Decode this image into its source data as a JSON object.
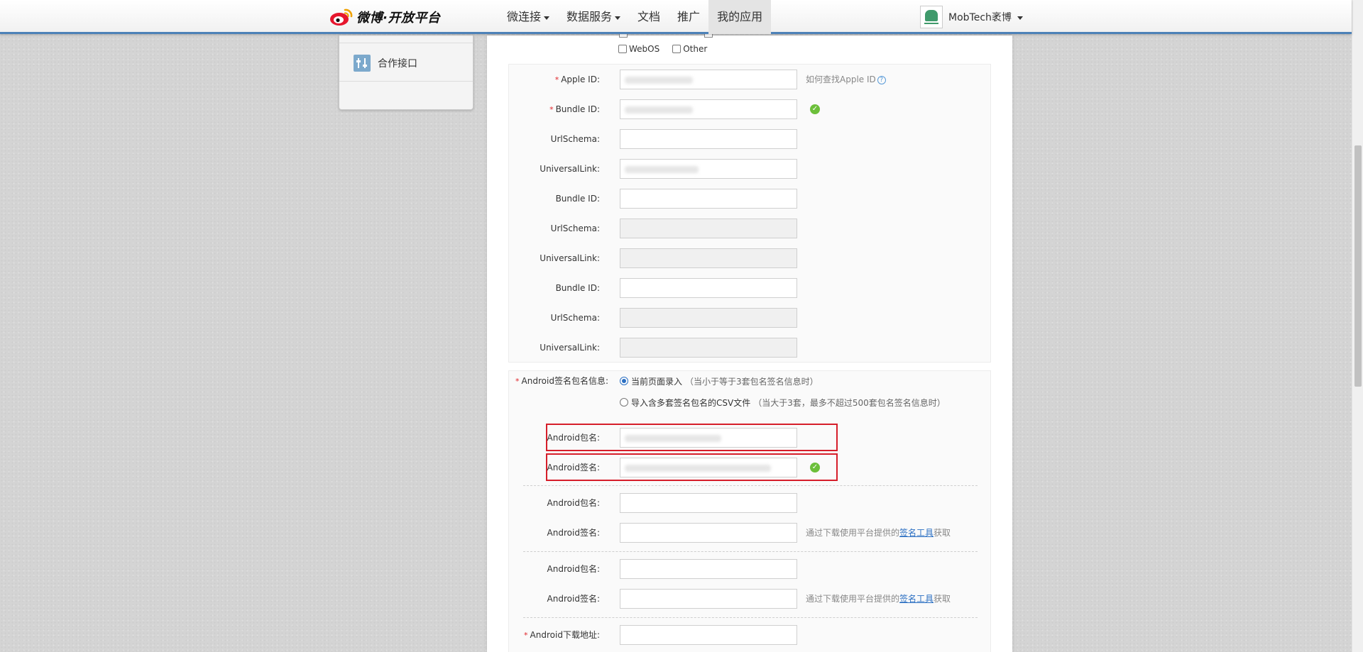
{
  "brand": {
    "logo_text": "微博·开放平台"
  },
  "nav": {
    "items": [
      {
        "label": "微连接",
        "caret": true
      },
      {
        "label": "数据服务",
        "caret": true
      },
      {
        "label": "文档",
        "caret": false
      },
      {
        "label": "推广",
        "caret": false
      },
      {
        "label": "我的应用",
        "caret": false,
        "active": true
      }
    ]
  },
  "user": {
    "name": "MobTech袤博"
  },
  "sidebar": {
    "item_label": "合作接口"
  },
  "platforms": {
    "webos": "WebOS",
    "other": "Other"
  },
  "ios": {
    "apple_id_label": "Apple ID:",
    "apple_id_hint": "如何查找Apple ID",
    "groups": [
      {
        "bundle_label": "Bundle ID:",
        "url_label": "UrlSchema:",
        "ul_label": "UniversalLink:"
      },
      {
        "bundle_label": "Bundle ID:",
        "url_label": "UrlSchema:",
        "ul_label": "UniversalLink:"
      },
      {
        "bundle_label": "Bundle ID:",
        "url_label": "UrlSchema:",
        "ul_label": "UniversalLink:"
      }
    ]
  },
  "android": {
    "sign_info_label": "Android签名包名信息:",
    "option_current": "当前页面录入",
    "option_current_sub": "（当小于等于3套包名签名信息时）",
    "option_csv": "导入含多套签名包名的CSV文件",
    "option_csv_sub": "（当大于3套，最多不超过500套包名签名信息时）",
    "pkg_label": "Android包名:",
    "sig_label": "Android签名:",
    "hint_prefix": "通过下载使用平台提供的",
    "hint_link": "签名工具",
    "hint_suffix": "获取",
    "download_label": "Android下载地址:"
  }
}
